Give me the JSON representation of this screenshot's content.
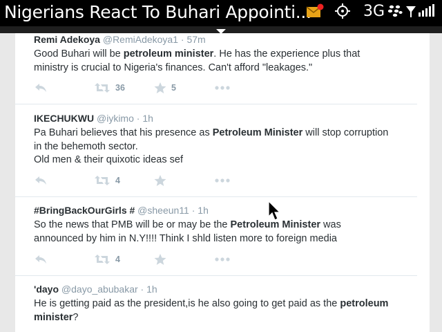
{
  "statusbar": {
    "title": "Nigerians React To Buhari Appointi...",
    "network": "3G",
    "icons": [
      "mail-notification-icon",
      "gps-icon",
      "blackberry-icon",
      "signal-icon",
      "battery-icon"
    ]
  },
  "tweets": [
    {
      "name": "Remi Adekoya",
      "handle": "@RemiAdekoya1",
      "time": "· 57m",
      "lines": [
        [
          "Good Buhari will be ",
          "petroleum minister",
          ". He has the experience plus that"
        ],
        [
          "ministry is crucial to Nigeria's finances. Can't afford \"leakages.\"",
          "",
          ""
        ]
      ],
      "retweets": "36",
      "favorites": "5"
    },
    {
      "name": "IKECHUKWU",
      "handle": "@iykimo",
      "time": "· 1h",
      "lines": [
        [
          "Pa Buhari believes that his presence as ",
          "Petroleum Minister",
          " will stop corruption"
        ],
        [
          "in the behemoth sector.",
          "",
          ""
        ],
        [
          "Old men & their quixotic ideas sef",
          "",
          ""
        ]
      ],
      "retweets": "4",
      "favorites": ""
    },
    {
      "name": "#BringBackOurGirls #",
      "handle": "@sheeun11",
      "time": "· 1h",
      "lines": [
        [
          "So the news that PMB will be or may be the ",
          "Petroleum Minister",
          " was"
        ],
        [
          "announced by him in N.Y!!!! Think I shld listen more to foreign media",
          "",
          ""
        ]
      ],
      "retweets": "4",
      "favorites": ""
    },
    {
      "name": "'dayo",
      "handle": "@dayo_abubakar",
      "time": "· 1h",
      "lines": [
        [
          "He is getting paid as the president,is he also going to get paid as the ",
          "petroleum",
          ""
        ],
        [
          "",
          "minister",
          "?"
        ]
      ],
      "retweets": "",
      "favorites": ""
    }
  ],
  "colors": {
    "text": "#292f33",
    "muted": "#8899a6",
    "action_icon": "#ccd6dd",
    "divider": "#e1e8ed"
  }
}
